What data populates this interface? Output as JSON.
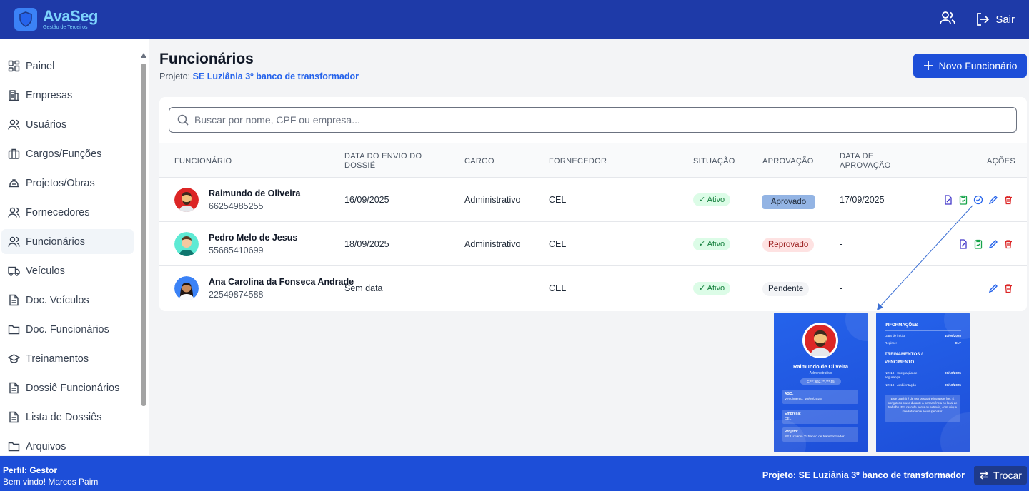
{
  "brand": {
    "name": "AvaSeg",
    "subtitle": "Gestão de Terceiros"
  },
  "header": {
    "logout_label": "Sair"
  },
  "sidebar": {
    "items": [
      {
        "label": "Painel",
        "icon": "dashboard-icon"
      },
      {
        "label": "Empresas",
        "icon": "building-icon"
      },
      {
        "label": "Usuários",
        "icon": "users-icon"
      },
      {
        "label": "Cargos/Funções",
        "icon": "briefcase-icon"
      },
      {
        "label": "Projetos/Obras",
        "icon": "hardhat-icon"
      },
      {
        "label": "Fornecedores",
        "icon": "users-icon"
      },
      {
        "label": "Funcionários",
        "icon": "users-icon",
        "active": true
      },
      {
        "label": "Veículos",
        "icon": "truck-icon"
      },
      {
        "label": "Doc. Veículos",
        "icon": "file-icon"
      },
      {
        "label": "Doc. Funcionários",
        "icon": "folder-icon"
      },
      {
        "label": "Treinamentos",
        "icon": "graduation-cap-icon"
      },
      {
        "label": "Dossiê Funcionários",
        "icon": "file-icon"
      },
      {
        "label": "Lista de Dossiês",
        "icon": "file-icon"
      },
      {
        "label": "Arquivos",
        "icon": "folder-icon"
      }
    ]
  },
  "page": {
    "title": "Funcionários",
    "subtitle_prefix": "Projeto:",
    "project_name": "SE Luziânia 3º banco de transformador",
    "new_button": "Novo Funcionário"
  },
  "search": {
    "placeholder": "Buscar por nome, CPF ou empresa..."
  },
  "table": {
    "headers": {
      "employee": "FUNCIONÁRIO",
      "sent_line1": "DATA DO ENVIO DO",
      "sent_line2": "DOSSIÊ",
      "role": "CARGO",
      "supplier": "FORNECEDOR",
      "status": "SITUAÇÃO",
      "approval": "APROVAÇÃO",
      "approval_date_line1": "DATA DE",
      "approval_date_line2": "APROVAÇÃO",
      "actions": "AÇÕES"
    },
    "rows": [
      {
        "name": "Raimundo de Oliveira",
        "cpf": "66254985255",
        "sent_date": "16/09/2025",
        "role": "Administrativo",
        "supplier": "CEL",
        "status": "✓ Ativo",
        "approval": "Aprovado",
        "approval_date": "17/09/2025"
      },
      {
        "name": "Pedro Melo de Jesus",
        "cpf": "55685410699",
        "sent_date": "18/09/2025",
        "role": "Administrativo",
        "supplier": "CEL",
        "status": "✓ Ativo",
        "approval": "Reprovado",
        "approval_date": "-"
      },
      {
        "name": "Ana Carolina da Fonseca Andrade",
        "cpf": "22549874588",
        "sent_date": "Sem data",
        "role": "",
        "supplier": "CEL",
        "status": "✓ Ativo",
        "approval": "Pendente",
        "approval_date": "-"
      }
    ]
  },
  "badge_preview": {
    "front": {
      "name": "Raimundo de Oliveira",
      "role": "Administrativo",
      "cpf": "CPF: 662.***.***.55",
      "aso_title": "ASO:",
      "aso_value": "Vencimento: 10/09/2025",
      "company_title": "Empresa:",
      "company_value": "CEL",
      "project_title": "Projeto:",
      "project_value": "SE Luziânia 3º banco de transformador"
    },
    "back": {
      "info_title": "INFORMAÇÕES",
      "start_label": "Data de início:",
      "start_value": "10/09/2025",
      "regime_label": "Regime:",
      "regime_value": "CLT",
      "trainings_title_1": "TREINAMENTOS /",
      "trainings_title_2": "VENCIMENTO",
      "nr18_label_1": "NR-18 - Integração de",
      "nr18_label_2": "segurança",
      "nr18_value": "06/10/2025",
      "nr18b_label": "NR-18 - Ambientação",
      "nr18b_value": "09/10/2025",
      "note": "Este crachá é de uso pessoal e intransferível. É obrigatório o uso durante a permanência no local de trabalho. Em caso de perda ou extravio, comunique imediatamente seu supervisor."
    }
  },
  "footer": {
    "profile": "Perfil: Gestor",
    "welcome": "Bem vindo! Marcos Paim",
    "project": "Projeto: SE Luziânia 3º banco de transformador",
    "switch_label": "Trocar"
  }
}
